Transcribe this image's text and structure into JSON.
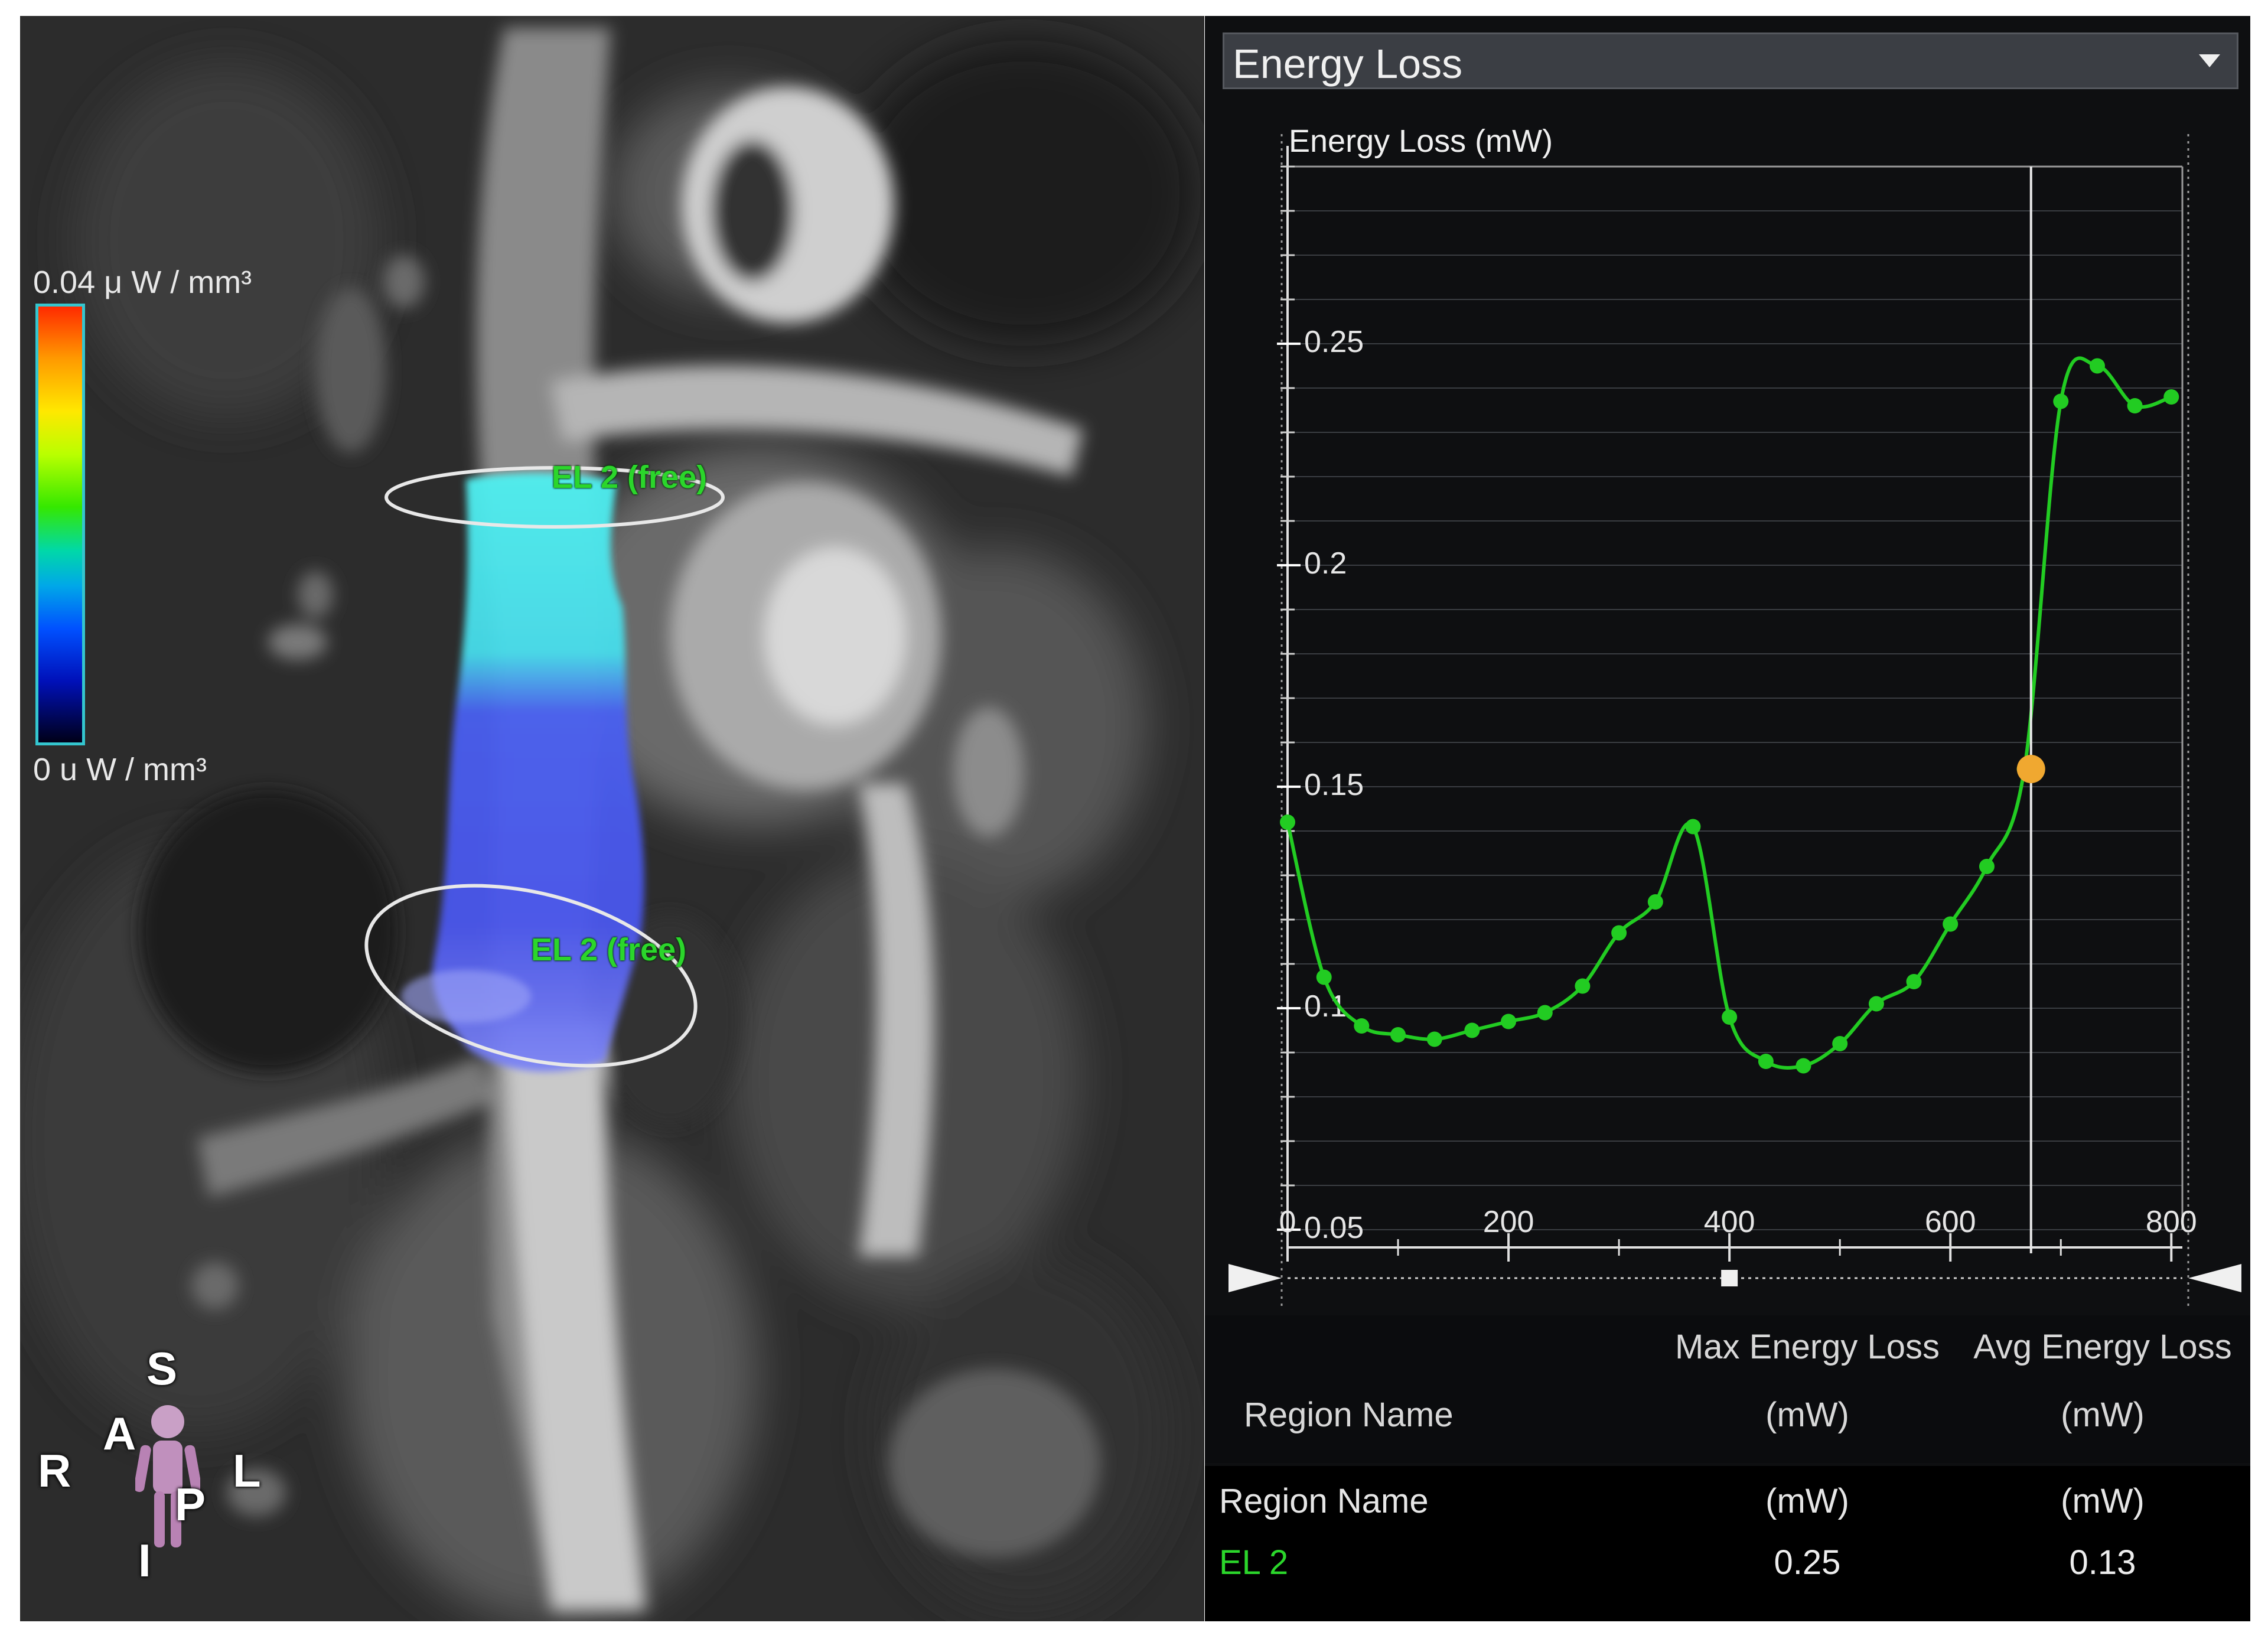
{
  "viewport": {
    "colorbar": {
      "max_label": "0.04 μ W / mm³",
      "min_label": "0 u W / mm³"
    },
    "roi_labels": [
      "EL 2 (free)",
      "EL 2 (free)"
    ],
    "orientation": {
      "superior": "S",
      "anterior": "A",
      "right": "R",
      "left": "L",
      "posterior": "P",
      "inferior": "I"
    },
    "icons": [
      "orientation-figure-icon"
    ]
  },
  "panel": {
    "dropdown": {
      "title": "Energy Loss",
      "icon": "chevron-down-icon"
    },
    "table": {
      "header": {
        "col_max": "Max Energy Loss",
        "col_avg": "Avg Energy Loss",
        "row_label": "Region Name",
        "unit_max": "(mW)",
        "unit_avg": "(mW)"
      },
      "columns": {
        "name": "Region Name",
        "max": "(mW)",
        "avg": "(mW)"
      },
      "rows": [
        {
          "name": "EL 2",
          "max": "0.25",
          "avg": "0.13",
          "color": "#2bd62b"
        }
      ]
    }
  },
  "chart_data": {
    "type": "line",
    "ylabel": "Energy Loss (mW)",
    "xlim": [
      0,
      810
    ],
    "ylim": [
      0.05,
      0.29
    ],
    "x_ticks": [
      0,
      200,
      400,
      600,
      800
    ],
    "y_ticks": [
      0.05,
      0.1,
      0.15,
      0.2,
      0.25
    ],
    "y_tick_labels": [
      "0.05",
      "0.1",
      "0.15",
      "0.2",
      "0.25"
    ],
    "grid": true,
    "series": [
      {
        "color": "#22cc22",
        "x": [
          0,
          33,
          67,
          100,
          133,
          167,
          200,
          233,
          267,
          300,
          333,
          367,
          400,
          433,
          467,
          500,
          533,
          567,
          600,
          633,
          667,
          700,
          733,
          767,
          800
        ],
        "y": [
          0.142,
          0.107,
          0.096,
          0.094,
          0.093,
          0.095,
          0.097,
          0.099,
          0.105,
          0.117,
          0.124,
          0.141,
          0.098,
          0.088,
          0.087,
          0.092,
          0.101,
          0.106,
          0.119,
          0.132,
          0.154,
          0.237,
          0.245,
          0.236,
          0.238
        ]
      }
    ],
    "cursor": {
      "x": 673,
      "y": 0.154,
      "color": "#f0a830"
    }
  }
}
